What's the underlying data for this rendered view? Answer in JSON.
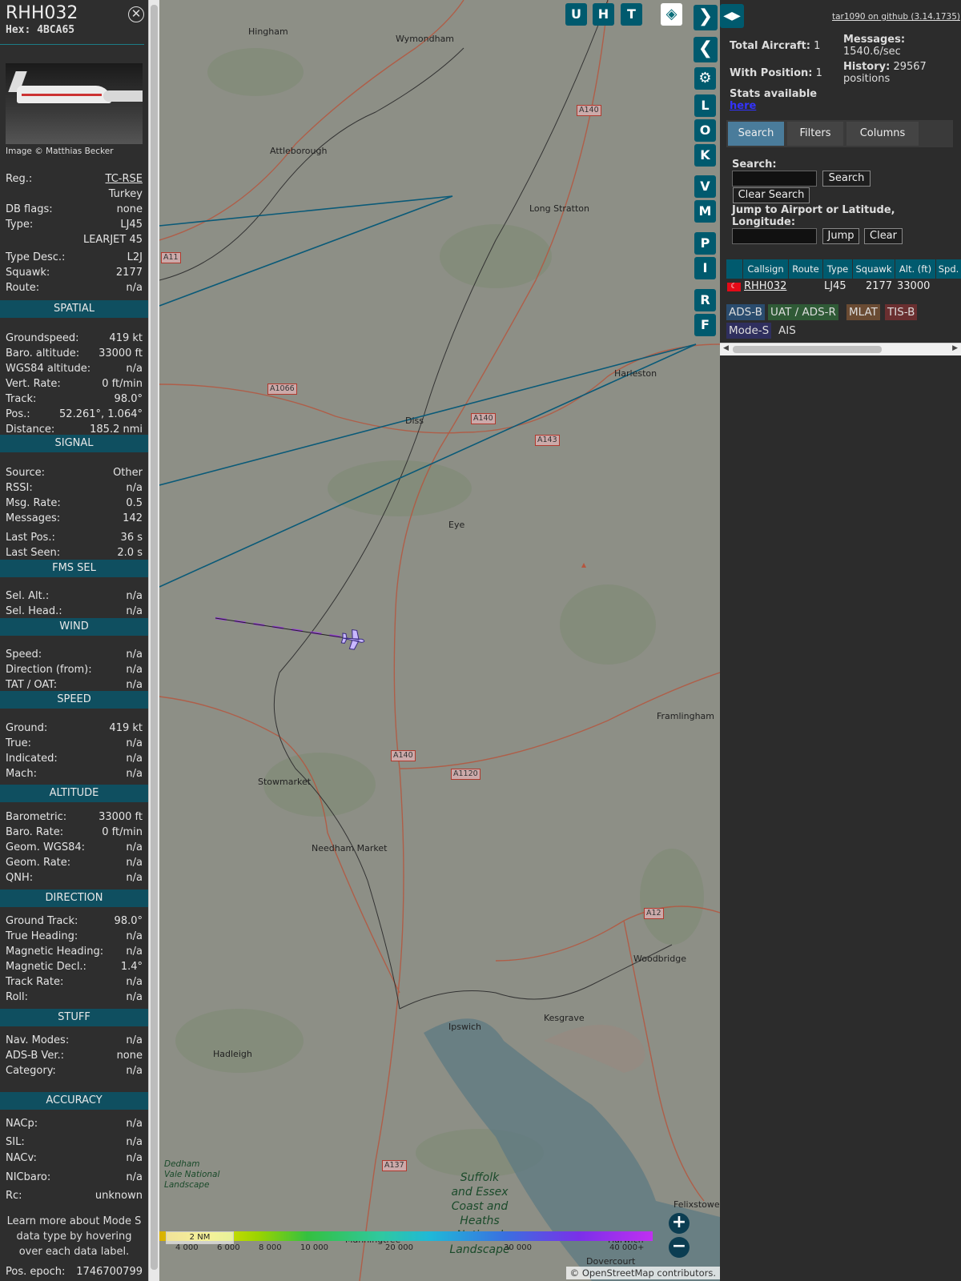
{
  "sidebar": {
    "callsign": "RHH032",
    "hex_label": "Hex:",
    "hex_value": "4BCA65",
    "image_credit": "Image © Matthias Becker",
    "basic": [
      {
        "k": "Reg.:",
        "v": "TC-RSE"
      },
      {
        "k": "",
        "v": "Turkey"
      },
      {
        "k": "DB flags:",
        "v": "none"
      },
      {
        "k": "Type:",
        "v": "LJ45"
      },
      {
        "k": "",
        "v": "LEARJET 45"
      },
      {
        "k": "Type Desc.:",
        "v": "L2J"
      },
      {
        "k": "Squawk:",
        "v": "2177"
      },
      {
        "k": "Route:",
        "v": "n/a"
      }
    ],
    "sections": [
      {
        "title": "SPATIAL",
        "rows": [
          {
            "k": "Groundspeed:",
            "v": "419 kt"
          },
          {
            "k": "Baro. altitude:",
            "v": "33000 ft"
          },
          {
            "k": "WGS84 altitude:",
            "v": "n/a"
          },
          {
            "k": "Vert. Rate:",
            "v": "0 ft/min"
          },
          {
            "k": "Track:",
            "v": "98.0°"
          },
          {
            "k": "Pos.:",
            "v": "52.261°, 1.064°"
          },
          {
            "k": "Distance:",
            "v": "185.2 nmi"
          }
        ]
      },
      {
        "title": "SIGNAL",
        "rows": [
          {
            "k": "Source:",
            "v": "Other"
          },
          {
            "k": "RSSI:",
            "v": "n/a"
          },
          {
            "k": "Msg. Rate:",
            "v": "0.5"
          },
          {
            "k": "Messages:",
            "v": "142"
          },
          {
            "k": "Last Pos.:",
            "v": "36 s"
          },
          {
            "k": "Last Seen:",
            "v": "2.0 s"
          }
        ]
      },
      {
        "title": "FMS SEL",
        "rows": [
          {
            "k": "Sel. Alt.:",
            "v": "n/a"
          },
          {
            "k": "Sel. Head.:",
            "v": "n/a"
          }
        ]
      },
      {
        "title": "WIND",
        "rows": [
          {
            "k": "Speed:",
            "v": "n/a"
          },
          {
            "k": "Direction (from):",
            "v": "n/a"
          },
          {
            "k": "TAT / OAT:",
            "v": "n/a"
          }
        ]
      },
      {
        "title": "SPEED",
        "rows": [
          {
            "k": "Ground:",
            "v": "419 kt"
          },
          {
            "k": "True:",
            "v": "n/a"
          },
          {
            "k": "Indicated:",
            "v": "n/a"
          },
          {
            "k": "Mach:",
            "v": "n/a"
          }
        ]
      },
      {
        "title": "ALTITUDE",
        "rows": [
          {
            "k": "Barometric:",
            "v": "33000 ft"
          },
          {
            "k": "Baro. Rate:",
            "v": "0 ft/min"
          },
          {
            "k": "Geom. WGS84:",
            "v": "n/a"
          },
          {
            "k": "Geom. Rate:",
            "v": "n/a"
          },
          {
            "k": "QNH:",
            "v": "n/a"
          }
        ]
      },
      {
        "title": "DIRECTION",
        "rows": [
          {
            "k": "Ground Track:",
            "v": "98.0°"
          },
          {
            "k": "True Heading:",
            "v": "n/a"
          },
          {
            "k": "Magnetic Heading:",
            "v": "n/a"
          },
          {
            "k": "Magnetic Decl.:",
            "v": "1.4°"
          },
          {
            "k": "Track Rate:",
            "v": "n/a"
          },
          {
            "k": "Roll:",
            "v": "n/a"
          }
        ]
      },
      {
        "title": "STUFF",
        "rows": [
          {
            "k": "Nav. Modes:",
            "v": "n/a"
          },
          {
            "k": "ADS-B Ver.:",
            "v": "none"
          },
          {
            "k": "Category:",
            "v": "n/a"
          }
        ]
      },
      {
        "title": "ACCURACY",
        "rows": [
          {
            "k": "NACp:",
            "v": "n/a"
          },
          {
            "k": "SIL:",
            "v": "n/a"
          },
          {
            "k": "NACv:",
            "v": "n/a"
          },
          {
            "k": "NICbaro:",
            "v": "n/a"
          },
          {
            "k": "Rc:",
            "v": "unknown"
          }
        ]
      }
    ],
    "note": "Learn more about Mode S data type by hovering over each data label.",
    "epoch_label": "Pos. epoch:",
    "epoch_value": "1746700799"
  },
  "map": {
    "buttons_top": [
      "U",
      "H",
      "T"
    ],
    "buttons_side": [
      "L",
      "O",
      "K",
      "V",
      "M",
      "P",
      "I",
      "R",
      "F"
    ],
    "towns": [
      "Hingham",
      "Wymondham",
      "Attleborough",
      "Long Stratton",
      "Harleston",
      "Diss",
      "Eye",
      "Framlingham",
      "Stowmarket",
      "Needham Market",
      "Woodbridge",
      "Kesgrave",
      "Ipswich",
      "Hadleigh",
      "Felixstowe",
      "Dovercourt",
      "Manningtree",
      "Harwich"
    ],
    "roads": [
      "A11",
      "A140",
      "A1066",
      "A140",
      "A143",
      "A140",
      "A1120",
      "A12",
      "A137",
      "A12"
    ],
    "aonb": [
      "Dedham",
      "Vale National",
      "Landscape",
      "Suffolk",
      "and Essex",
      "Coast and",
      "Heaths",
      "National",
      "Landscape"
    ],
    "scale": "2 NM",
    "colorbar_ticks": [
      "4 000",
      "6 000",
      "8 000",
      "10 000",
      "20 000",
      "30 000",
      "40 000+"
    ],
    "attribution": "© OpenStreetMap contributors.",
    "zoom_in": "+",
    "zoom_out": "−"
  },
  "right": {
    "github_link": "tar1090 on github (3.14.1735)",
    "total_label": "Total Aircraft:",
    "total_value": "1",
    "withpos_label": "With Position:",
    "withpos_value": "1",
    "messages_label": "Messages:",
    "messages_value": "1540.6/sec",
    "history_label": "History:",
    "history_value": "29567 positions",
    "stats_label": "Stats available",
    "stats_link": "here",
    "tabs": [
      "Search",
      "Filters",
      "Columns"
    ],
    "search_label": "Search:",
    "search_btn": "Search",
    "clear_search_btn": "Clear Search",
    "jump_label": "Jump to Airport or Latitude, Longitude:",
    "jump_btn": "Jump",
    "clear_btn": "Clear",
    "table_headers": [
      "",
      "Callsign",
      "Route",
      "Type",
      "Squawk",
      "Alt. (ft)",
      "Spd."
    ],
    "table_rows": [
      {
        "callsign": "RHH032",
        "route": "",
        "type": "LJ45",
        "squawk": "2177",
        "alt": "33000"
      }
    ],
    "badges": [
      {
        "label": "ADS-B",
        "color": "#2a4c6e"
      },
      {
        "label": "UAT / ADS-R",
        "color": "#2f5a36"
      },
      {
        "label": "MLAT",
        "color": "#6a4b33"
      },
      {
        "label": "TIS-B",
        "color": "#6a2f30"
      },
      {
        "label": "Mode-S",
        "color": "#2f2f5e"
      },
      {
        "label": "AIS",
        "color": "#2c2c2c"
      }
    ]
  },
  "colors": {
    "accent": "#005a6e",
    "section": "#0f4f60",
    "track": "#0a5a78"
  }
}
